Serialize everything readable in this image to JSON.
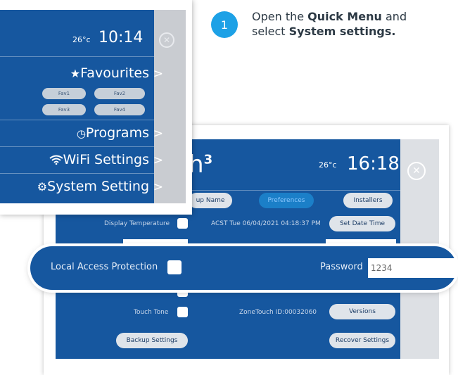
{
  "step": {
    "number": "1",
    "line1_prefix": "Open the ",
    "line1_bold": "Quick Menu",
    "line1_suffix": " and",
    "line2_prefix": "select ",
    "line2_bold": "System settings."
  },
  "back_screen": {
    "logo": "h",
    "logo_sup": "3",
    "temperature": "26°c",
    "time": "16:18",
    "tabs": {
      "name": "up Name",
      "preferences": "Preferences",
      "installers": "Installers"
    },
    "display_temperature_label": "Display Temperature",
    "date_time": "ACST Tue 06/04/2021 04:18:37 PM",
    "set_date_time": "Set Date Time",
    "touch_tone_label": "Touch Tone",
    "zonetouch_id": "ZoneTouch ID:00032060",
    "versions": "Versions",
    "backup_settings": "Backup Settings",
    "recover_settings": "Recover Settings"
  },
  "highlight": {
    "local_access_protection": "Local Access Protection",
    "password_label": "Password",
    "password_value": "1234"
  },
  "quick_menu": {
    "temperature": "26°c",
    "time": "10:14",
    "items": [
      {
        "label": "Favourites",
        "icon": "star-icon",
        "chevron": ">"
      },
      {
        "label": "Programs",
        "icon": "clock-icon",
        "chevron": ">"
      },
      {
        "label": "WiFi Settings",
        "icon": "wifi-icon",
        "chevron": ">"
      },
      {
        "label": "System Setting",
        "icon": "gear-icon",
        "chevron": ">"
      }
    ],
    "favs": [
      "Fav1",
      "Fav2",
      "Fav3",
      "Fav4"
    ]
  },
  "colors": {
    "panel_blue": "#16579f",
    "accent": "#1da1e6",
    "grey": "#c9ccd1"
  }
}
